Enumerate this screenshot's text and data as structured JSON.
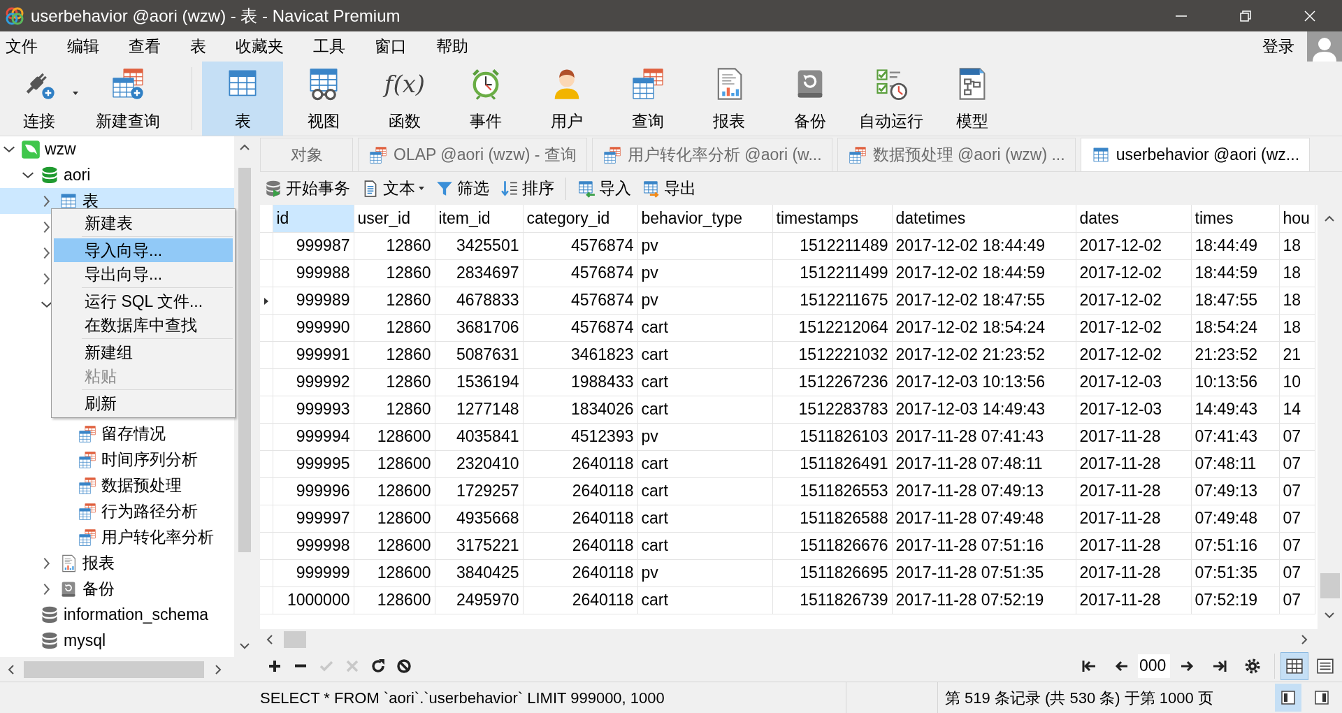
{
  "window": {
    "title": "userbehavior @aori (wzw) - 表 - Navicat Premium"
  },
  "menu_bar": [
    "文件",
    "编辑",
    "查看",
    "表",
    "收藏夹",
    "工具",
    "窗口",
    "帮助"
  ],
  "account": {
    "label": "登录"
  },
  "toolbar": [
    {
      "label": "连接",
      "kind": "connect",
      "selected": false,
      "dropdown": true
    },
    {
      "label": "新建查询",
      "kind": "newquery",
      "selected": false,
      "dropdown": false
    },
    {
      "label": "表",
      "kind": "table",
      "selected": true,
      "dropdown": false
    },
    {
      "label": "视图",
      "kind": "view",
      "selected": false,
      "dropdown": false
    },
    {
      "label": "函数",
      "kind": "function",
      "glyph": "f(x)",
      "selected": false,
      "dropdown": false
    },
    {
      "label": "事件",
      "kind": "event",
      "selected": false,
      "dropdown": false
    },
    {
      "label": "用户",
      "kind": "user",
      "selected": false,
      "dropdown": false
    },
    {
      "label": "查询",
      "kind": "query",
      "selected": false,
      "dropdown": false
    },
    {
      "label": "报表",
      "kind": "report",
      "selected": false,
      "dropdown": false
    },
    {
      "label": "备份",
      "kind": "backup",
      "selected": false,
      "dropdown": false
    },
    {
      "label": "自动运行",
      "kind": "auto",
      "selected": false,
      "dropdown": false
    },
    {
      "label": "模型",
      "kind": "model",
      "selected": false,
      "dropdown": false
    }
  ],
  "tree": [
    {
      "label": "wzw",
      "kind": "connection",
      "expanded": true,
      "selected": false,
      "children": [
        {
          "label": "aori",
          "kind": "database",
          "expanded": true,
          "selected": false,
          "children": [
            {
              "label": "表",
              "kind": "table",
              "expanded": false,
              "selected": true
            },
            {
              "kind": "hidden",
              "expanded": false,
              "selected": false
            },
            {
              "kind": "hidden",
              "expanded": false,
              "selected": false
            },
            {
              "kind": "hidden",
              "expanded": false,
              "selected": false
            },
            {
              "kind": "hidden",
              "expanded": true,
              "selected": false,
              "children": [
                {
                  "label": "留存情况",
                  "kind": "query",
                  "selected": false
                },
                {
                  "label": "时间序列分析",
                  "kind": "query",
                  "selected": false
                },
                {
                  "label": "数据预处理",
                  "kind": "query",
                  "selected": false
                },
                {
                  "label": "行为路径分析",
                  "kind": "query",
                  "selected": false
                },
                {
                  "label": "用户转化率分析",
                  "kind": "query",
                  "selected": false
                }
              ]
            },
            {
              "label": "报表",
              "kind": "report",
              "expanded": false,
              "selected": false
            },
            {
              "label": "备份",
              "kind": "backup",
              "expanded": false,
              "selected": false
            }
          ]
        },
        {
          "label": "information_schema",
          "kind": "database",
          "selected": false
        },
        {
          "label": "mysql",
          "kind": "database",
          "selected": false
        }
      ]
    }
  ],
  "context_menu": {
    "items": [
      {
        "label": "新建表",
        "selected": false,
        "disabled": false
      },
      {
        "kind": "separator"
      },
      {
        "label": "导入向导...",
        "selected": true,
        "disabled": false
      },
      {
        "label": "导出向导...",
        "selected": false,
        "disabled": false
      },
      {
        "kind": "separator"
      },
      {
        "label": "运行 SQL 文件...",
        "selected": false,
        "disabled": false
      },
      {
        "label": "在数据库中查找",
        "selected": false,
        "disabled": false
      },
      {
        "kind": "separator"
      },
      {
        "label": "新建组",
        "selected": false,
        "disabled": false
      },
      {
        "label": "粘贴",
        "selected": false,
        "disabled": true
      },
      {
        "kind": "separator"
      },
      {
        "label": "刷新",
        "selected": false,
        "disabled": false
      }
    ]
  },
  "tabs": [
    {
      "label": "对象",
      "kind": "objects",
      "selected": false
    },
    {
      "label": "OLAP @aori (wzw) - 查询",
      "kind": "query",
      "selected": false
    },
    {
      "label": "用户转化率分析 @aori (w...",
      "kind": "query",
      "selected": false
    },
    {
      "label": "数据预处理 @aori (wzw) ...",
      "kind": "query",
      "selected": false
    },
    {
      "label": "userbehavior @aori (wz...",
      "kind": "table",
      "selected": true
    }
  ],
  "grid_toolbar": [
    {
      "label": "开始事务",
      "kind": "transaction",
      "dropdown": false
    },
    {
      "label": "文本",
      "kind": "text",
      "dropdown": true
    },
    {
      "label": "筛选",
      "kind": "filter",
      "dropdown": false
    },
    {
      "label": "排序",
      "kind": "sort",
      "dropdown": false
    },
    {
      "label": "导入",
      "kind": "import",
      "dropdown": false
    },
    {
      "label": "导出",
      "kind": "export",
      "dropdown": false
    }
  ],
  "table": {
    "columns": [
      {
        "label": "id",
        "selected": true
      },
      {
        "label": "user_id",
        "selected": false
      },
      {
        "label": "item_id",
        "selected": false
      },
      {
        "label": "category_id",
        "selected": false
      },
      {
        "label": "behavior_type",
        "selected": false
      },
      {
        "label": "timestamps",
        "selected": false
      },
      {
        "label": "datetimes",
        "selected": false
      },
      {
        "label": "dates",
        "selected": false
      },
      {
        "label": "times",
        "selected": false
      },
      {
        "label": "hou",
        "selected": false
      }
    ],
    "rows": [
      {
        "current": false,
        "cells": [
          "999987",
          "12860",
          "3425501",
          "4576874",
          "pv",
          "1512211489",
          "2017-12-02 18:44:49",
          "2017-12-02",
          "18:44:49",
          "18"
        ]
      },
      {
        "current": false,
        "cells": [
          "999988",
          "12860",
          "2834697",
          "4576874",
          "pv",
          "1512211499",
          "2017-12-02 18:44:59",
          "2017-12-02",
          "18:44:59",
          "18"
        ]
      },
      {
        "current": true,
        "cells": [
          "999989",
          "12860",
          "4678833",
          "4576874",
          "pv",
          "1512211675",
          "2017-12-02 18:47:55",
          "2017-12-02",
          "18:47:55",
          "18"
        ]
      },
      {
        "current": false,
        "cells": [
          "999990",
          "12860",
          "3681706",
          "4576874",
          "cart",
          "1512212064",
          "2017-12-02 18:54:24",
          "2017-12-02",
          "18:54:24",
          "18"
        ]
      },
      {
        "current": false,
        "cells": [
          "999991",
          "12860",
          "5087631",
          "3461823",
          "cart",
          "1512221032",
          "2017-12-02 21:23:52",
          "2017-12-02",
          "21:23:52",
          "21"
        ]
      },
      {
        "current": false,
        "cells": [
          "999992",
          "12860",
          "1536194",
          "1988433",
          "cart",
          "1512267236",
          "2017-12-03 10:13:56",
          "2017-12-03",
          "10:13:56",
          "10"
        ]
      },
      {
        "current": false,
        "cells": [
          "999993",
          "12860",
          "1277148",
          "1834026",
          "cart",
          "1512283783",
          "2017-12-03 14:49:43",
          "2017-12-03",
          "14:49:43",
          "14"
        ]
      },
      {
        "current": false,
        "cells": [
          "999994",
          "128600",
          "4035841",
          "4512393",
          "pv",
          "1511826103",
          "2017-11-28 07:41:43",
          "2017-11-28",
          "07:41:43",
          "07"
        ]
      },
      {
        "current": false,
        "cells": [
          "999995",
          "128600",
          "2320410",
          "2640118",
          "cart",
          "1511826491",
          "2017-11-28 07:48:11",
          "2017-11-28",
          "07:48:11",
          "07"
        ]
      },
      {
        "current": false,
        "cells": [
          "999996",
          "128600",
          "1729257",
          "2640118",
          "cart",
          "1511826553",
          "2017-11-28 07:49:13",
          "2017-11-28",
          "07:49:13",
          "07"
        ]
      },
      {
        "current": false,
        "cells": [
          "999997",
          "128600",
          "4935668",
          "2640118",
          "cart",
          "1511826588",
          "2017-11-28 07:49:48",
          "2017-11-28",
          "07:49:48",
          "07"
        ]
      },
      {
        "current": false,
        "cells": [
          "999998",
          "128600",
          "3175221",
          "2640118",
          "cart",
          "1511826676",
          "2017-11-28 07:51:16",
          "2017-11-28",
          "07:51:16",
          "07"
        ]
      },
      {
        "current": false,
        "cells": [
          "999999",
          "128600",
          "3840425",
          "2640118",
          "pv",
          "1511826695",
          "2017-11-28 07:51:35",
          "2017-11-28",
          "07:51:35",
          "07"
        ]
      },
      {
        "current": false,
        "cells": [
          "1000000",
          "128600",
          "2495970",
          "2640118",
          "cart",
          "1511826739",
          "2017-11-28 07:52:19",
          "2017-11-28",
          "07:52:19",
          "07"
        ]
      }
    ]
  },
  "edit_buttons": [
    {
      "kind": "add",
      "disabled": false
    },
    {
      "kind": "remove",
      "disabled": false
    },
    {
      "kind": "apply",
      "disabled": true
    },
    {
      "kind": "discard",
      "disabled": true
    },
    {
      "kind": "refresh",
      "disabled": false
    },
    {
      "kind": "stop",
      "disabled": false
    }
  ],
  "pager": {
    "buttons_before": [
      {
        "kind": "first"
      },
      {
        "kind": "prev"
      }
    ],
    "page_field": {
      "value": "000"
    },
    "buttons_after": [
      {
        "kind": "next"
      },
      {
        "kind": "last"
      },
      {
        "kind": "settings"
      }
    ]
  },
  "view_toggles": [
    {
      "kind": "grid",
      "selected": true
    },
    {
      "kind": "form",
      "selected": false
    }
  ],
  "status_bar": {
    "sql": "SELECT * FROM `aori`.`userbehavior` LIMIT 999000, 1000",
    "records": "第 519 条记录 (共 530 条) 于第 1000 页",
    "panes": [
      {
        "kind": "left",
        "selected": true
      },
      {
        "kind": "right",
        "selected": false
      }
    ]
  }
}
